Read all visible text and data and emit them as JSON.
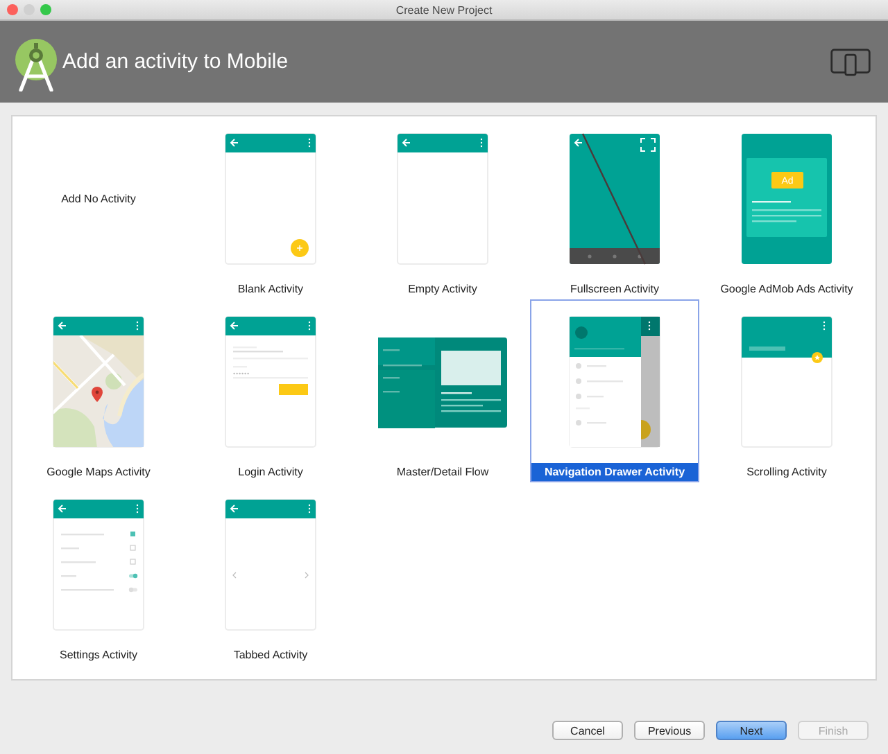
{
  "window": {
    "title": "Create New Project"
  },
  "header": {
    "title": "Add an activity to Mobile"
  },
  "activities": [
    {
      "label": "Add No Activity",
      "kind": "none",
      "selected": false
    },
    {
      "label": "Blank Activity",
      "kind": "blank",
      "selected": false
    },
    {
      "label": "Empty Activity",
      "kind": "empty",
      "selected": false
    },
    {
      "label": "Fullscreen Activity",
      "kind": "fullscreen",
      "selected": false
    },
    {
      "label": "Google AdMob Ads Activity",
      "kind": "admob",
      "badge": "Ad",
      "selected": false
    },
    {
      "label": "Google Maps Activity",
      "kind": "maps",
      "selected": false
    },
    {
      "label": "Login Activity",
      "kind": "login",
      "selected": false
    },
    {
      "label": "Master/Detail Flow",
      "kind": "masterdetail",
      "selected": false
    },
    {
      "label": "Navigation Drawer Activity",
      "kind": "drawer",
      "selected": true
    },
    {
      "label": "Scrolling Activity",
      "kind": "scrolling",
      "selected": false
    },
    {
      "label": "Settings Activity",
      "kind": "settings",
      "selected": false
    },
    {
      "label": "Tabbed Activity",
      "kind": "tabbed",
      "selected": false
    }
  ],
  "buttons": [
    {
      "label": "Cancel",
      "kind": "normal"
    },
    {
      "label": "Previous",
      "kind": "normal"
    },
    {
      "label": "Next",
      "kind": "default"
    },
    {
      "label": "Finish",
      "kind": "disabled"
    }
  ]
}
